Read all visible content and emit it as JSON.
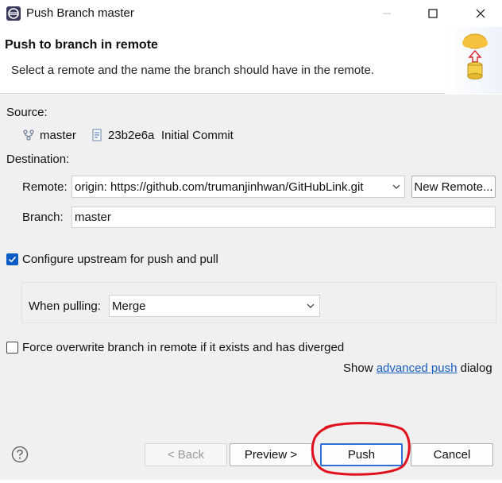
{
  "window": {
    "title": "Push Branch master"
  },
  "banner": {
    "title": "Push to branch in remote",
    "description": "Select a remote and the name the branch should have in the remote."
  },
  "source": {
    "label": "Source:",
    "branch": "master",
    "commit_id": "23b2e6a",
    "commit_message": "Initial Commit"
  },
  "destination": {
    "label": "Destination:",
    "remote_label": "Remote:",
    "remote_value": "origin: https://github.com/trumanjinhwan/GitHubLink.git",
    "new_remote_label": "New Remote...",
    "branch_label": "Branch:",
    "branch_value": "master"
  },
  "upstream": {
    "configure_label": "Configure upstream for push and pull",
    "configure_checked": true,
    "when_pulling_label": "When pulling:",
    "when_pulling_value": "Merge"
  },
  "force": {
    "label": "Force overwrite branch in remote if it exists and has diverged",
    "checked": false
  },
  "advanced": {
    "prefix": "Show ",
    "link": "advanced push",
    "suffix": " dialog"
  },
  "footer": {
    "back_label": "< Back",
    "preview_label": "Preview >",
    "push_label": "Push",
    "cancel_label": "Cancel"
  },
  "colors": {
    "accent": "#0b5cc7",
    "link": "#1a5fbf",
    "annotation": "#e0101c"
  }
}
